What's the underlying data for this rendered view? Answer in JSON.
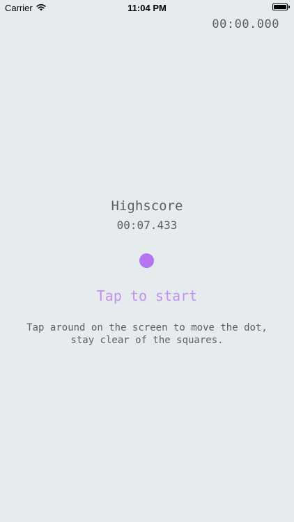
{
  "status_bar": {
    "carrier": "Carrier",
    "time": "11:04 PM"
  },
  "game": {
    "timer": "00:00.000",
    "highscore_label": "Highscore",
    "highscore_value": "00:07.433",
    "tap_to_start": "Tap to start",
    "instructions_line1": "Tap around on the screen to move the dot,",
    "instructions_line2": "stay clear of the squares."
  },
  "colors": {
    "background": "#e6ebee",
    "dot": "#b474f2",
    "accent_text": "#c290f0",
    "text": "#5b5f63"
  },
  "icons": [
    "wifi-icon",
    "battery-icon"
  ]
}
